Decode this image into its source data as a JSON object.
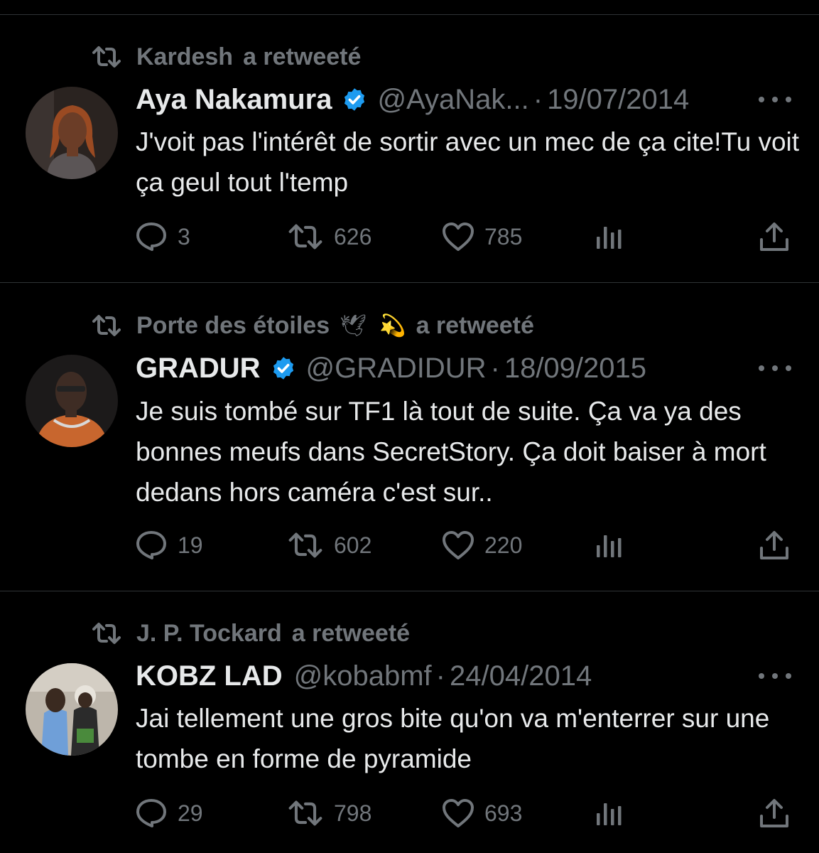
{
  "tweets": [
    {
      "retweeter": "Kardesh",
      "retweet_suffix": "a retweeté",
      "name": "Aya Nakamura",
      "verified": true,
      "handle": "@AyaNak...",
      "separator": "·",
      "date": "19/07/2014",
      "text": "J'voit pas l'intérêt de sortir avec un mec de ça cite!Tu voit ça geul tout l'temp",
      "replies": "3",
      "retweets": "626",
      "likes": "785"
    },
    {
      "retweeter": "Porte des étoiles",
      "retweeter_emoji_1": "🕊",
      "retweeter_emoji_2": "💫",
      "retweet_suffix": "a retweeté",
      "name": "GRADUR",
      "verified": true,
      "handle": "@GRADIDUR",
      "separator": "·",
      "date": "18/09/2015",
      "text": "Je suis tombé sur TF1 là tout de suite. Ça va ya des bonnes meufs dans SecretStory. Ça doit baiser à mort dedans hors caméra c'est sur..",
      "replies": "19",
      "retweets": "602",
      "likes": "220"
    },
    {
      "retweeter": "J. P. Tockard",
      "retweet_suffix": "a retweeté",
      "name": "KOBZ LAD",
      "verified": false,
      "handle": "@kobabmf",
      "separator": "·",
      "date": "24/04/2014",
      "text": "Jai tellement une gros bite qu'on va m'enterrer sur une tombe en forme de pyramide",
      "replies": "29",
      "retweets": "798",
      "likes": "693"
    }
  ],
  "colors": {
    "background": "#000000",
    "text_primary": "#e7e9ea",
    "text_secondary": "#71767b",
    "divider": "#2f3336",
    "verified_badge": "#1d9bf0"
  },
  "icons": {
    "retweet": "retweet-icon",
    "verified": "verified-badge-icon",
    "more": "more-icon",
    "reply": "reply-icon",
    "like": "heart-icon",
    "views": "views-icon",
    "share": "share-icon"
  }
}
